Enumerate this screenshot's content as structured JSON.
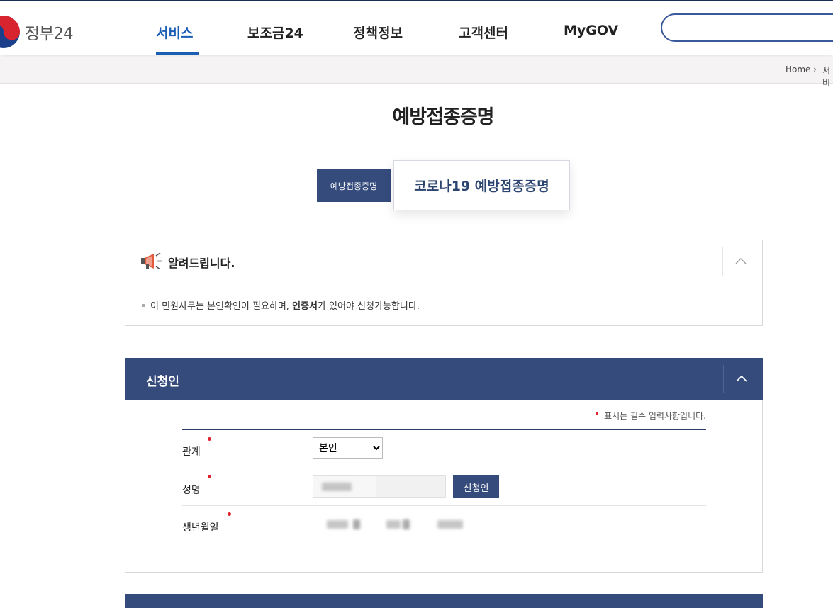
{
  "header": {
    "logo_text": "정부24",
    "nav": [
      "서비스",
      "보조금24",
      "정책정보",
      "고객센터",
      "MyGOV"
    ],
    "active_nav": "서비스",
    "search_placeholder": ""
  },
  "breadcrumb": {
    "home": "Home",
    "next": "서비"
  },
  "page": {
    "title": "예방접종증명",
    "tabs": [
      "예방접종증명",
      "코로나19 예방접종증명"
    ],
    "active_tab": "코로나19 예방접종증명"
  },
  "notice": {
    "title": "알려드립니다.",
    "text_before": "이 민원사무는 본인확인이 필요하며, ",
    "text_bold": "인증서",
    "text_after": "가 있어야 신청가능합니다."
  },
  "applicant": {
    "title": "신청인",
    "required_note": "표시는 필수 입력사항입니다.",
    "relation_label": "관계",
    "relation_value": "본인",
    "name_label": "성명",
    "apply_button": "신청인",
    "birth_label": "생년월일"
  },
  "colors": {
    "primary": "#344b7c",
    "nav_active": "#1a5fb4",
    "required": "#e0202a"
  }
}
